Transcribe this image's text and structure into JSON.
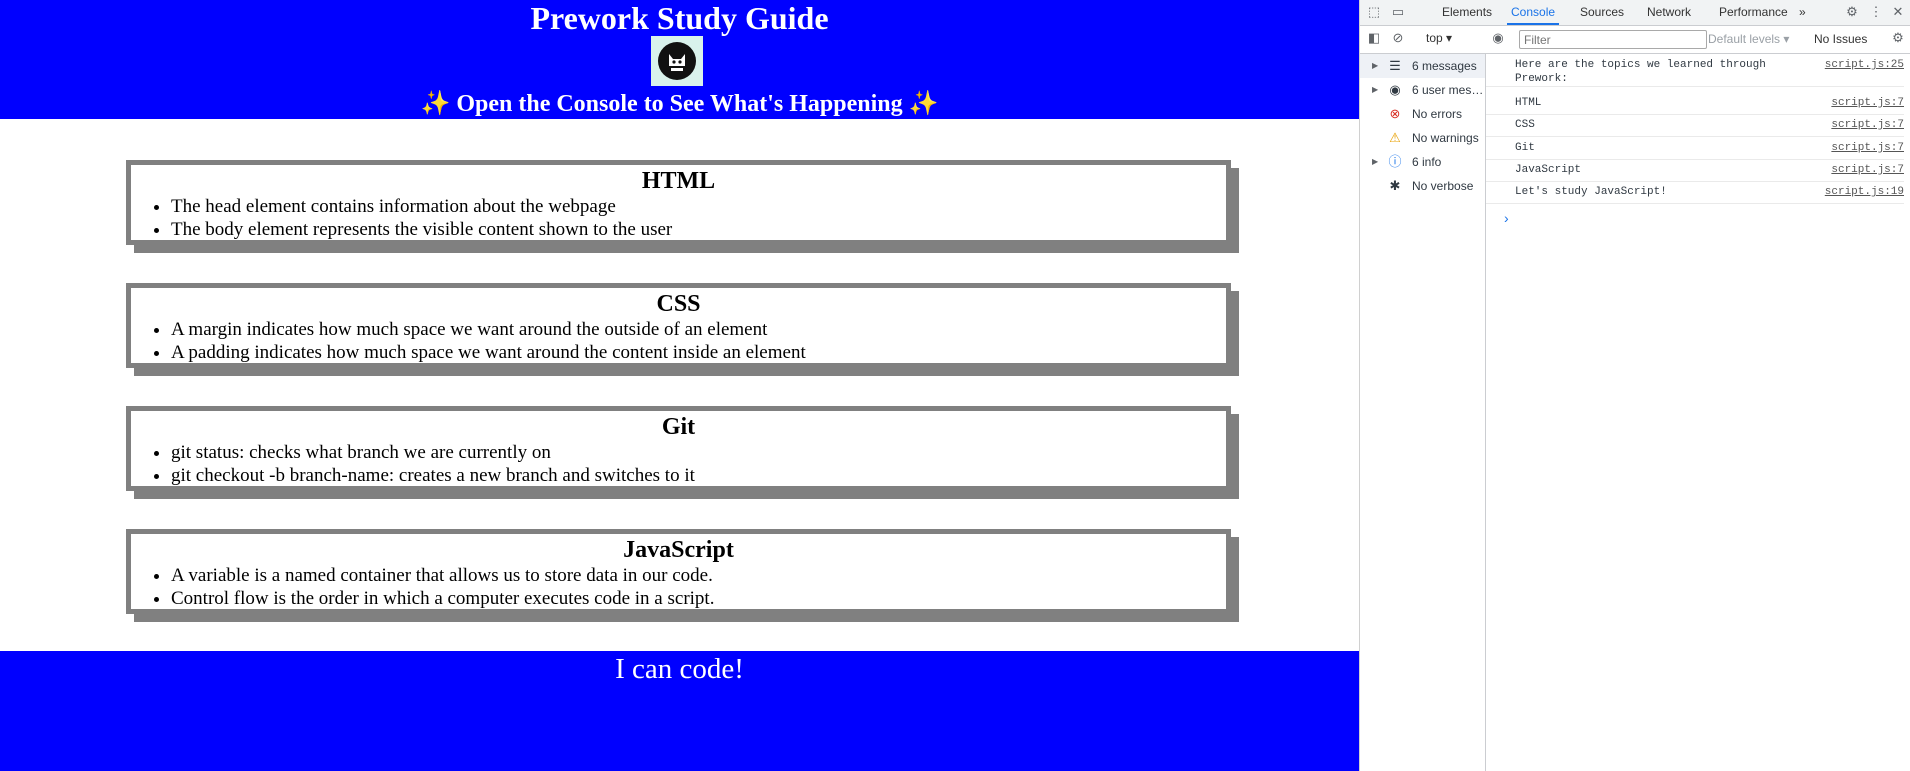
{
  "page": {
    "title": "Prework Study Guide",
    "subtitle": "Open the Console to See What's Happening",
    "sparkle": "✨",
    "footer": "I can code!",
    "colors": {
      "header_bg": "#0000ff",
      "card_border": "#808080"
    },
    "sections": [
      {
        "title": "HTML",
        "items": [
          "The head element contains information about the webpage",
          "The body element represents the visible content shown to the user"
        ]
      },
      {
        "title": "CSS",
        "items": [
          "A margin indicates how much space we want around the outside of an element",
          "A padding indicates how much space we want around the content inside an element"
        ]
      },
      {
        "title": "Git",
        "items": [
          "git status: checks what branch we are currently on",
          "git checkout -b branch-name: creates a new branch and switches to it"
        ]
      },
      {
        "title": "JavaScript",
        "items": [
          "A variable is a named container that allows us to store data in our code.",
          "Control flow is the order in which a computer executes code in a script."
        ]
      }
    ]
  },
  "devtools": {
    "tabs": [
      "Elements",
      "Console",
      "Sources",
      "Network",
      "Performance"
    ],
    "active_tab": "Console",
    "more_tabs": "»",
    "context": "top",
    "filter_placeholder": "Filter",
    "levels": "Default levels ▾",
    "issues": "No Issues",
    "sidebar": [
      {
        "label": "6 messages",
        "icon": "list-icon",
        "glyph": "☰",
        "expandable": true
      },
      {
        "label": "6 user mes…",
        "icon": "user-icon",
        "glyph": "◉",
        "expandable": true
      },
      {
        "label": "No errors",
        "icon": "error-icon",
        "glyph": "⊗",
        "expandable": false
      },
      {
        "label": "No warnings",
        "icon": "warning-icon",
        "glyph": "⚠",
        "expandable": false
      },
      {
        "label": "6 info",
        "icon": "info-icon",
        "glyph": "ⓘ",
        "expandable": true
      },
      {
        "label": "No verbose",
        "icon": "bug-icon",
        "glyph": "✱",
        "expandable": false
      }
    ],
    "messages": [
      {
        "text": "Here are the topics we learned through Prework:",
        "source": "script.js:25"
      },
      {
        "text": "HTML",
        "source": "script.js:7"
      },
      {
        "text": "CSS",
        "source": "script.js:7"
      },
      {
        "text": "Git",
        "source": "script.js:7"
      },
      {
        "text": "JavaScript",
        "source": "script.js:7"
      },
      {
        "text": "Let's study JavaScript!",
        "source": "script.js:19"
      }
    ],
    "prompt_symbol": "›"
  }
}
